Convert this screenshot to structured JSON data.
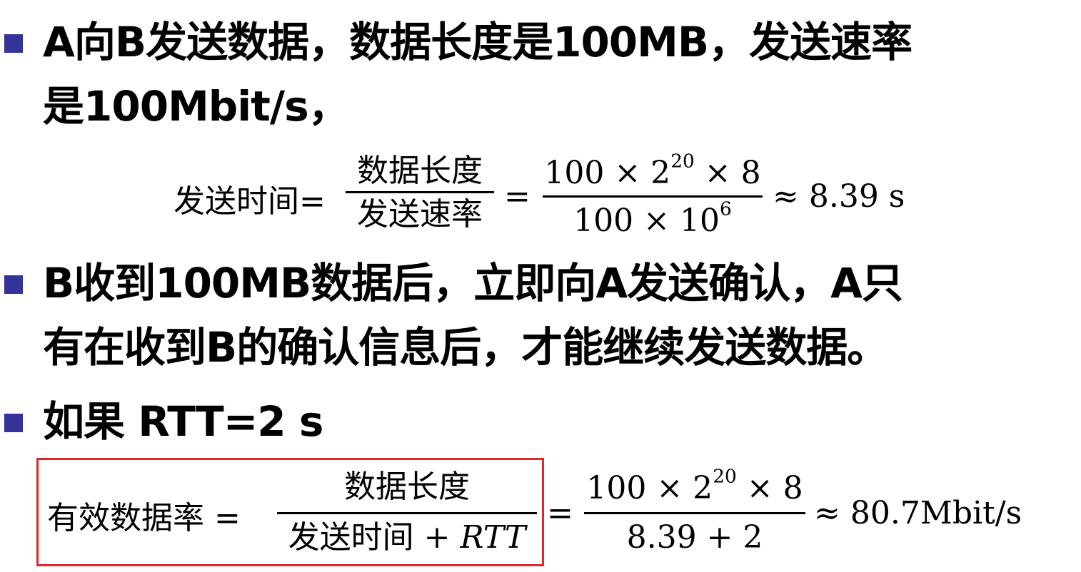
{
  "bullets": [
    {
      "line1": "A向B发送数据，数据长度是100MB，发送速率",
      "line2": "是100Mbit/s，"
    },
    {
      "line1": "B收到100MB数据后，立即向A发送确认，A只",
      "line2": "有在收到B的确认信息后，才能继续发送数据。"
    },
    {
      "line1": "如果 RTT=2 s"
    }
  ],
  "formula1": {
    "lhs": "发送时间=",
    "frac1_num": "数据长度",
    "frac1_den": "发送速率",
    "eq": "=",
    "frac2_num_a": "100 × 2",
    "frac2_num_exp": "20",
    "frac2_num_b": " × 8",
    "frac2_den_a": "100 × 10",
    "frac2_den_exp": "6",
    "result": "≈ 8.39 s"
  },
  "formula2": {
    "lhs": "有效数据率 =",
    "frac1_num": "数据长度",
    "frac1_den_cjk": "发送时间",
    "frac1_den_rest": " + RTT",
    "eq": "=",
    "frac2_num_a": "100 × 2",
    "frac2_num_exp": "20",
    "frac2_num_b": " × 8",
    "frac2_den": "8.39 + 2",
    "result": "≈ 80.7Mbit/s"
  },
  "colors": {
    "bullet": "#333399",
    "highlight_box": "#e0262b",
    "text": "#000000"
  }
}
